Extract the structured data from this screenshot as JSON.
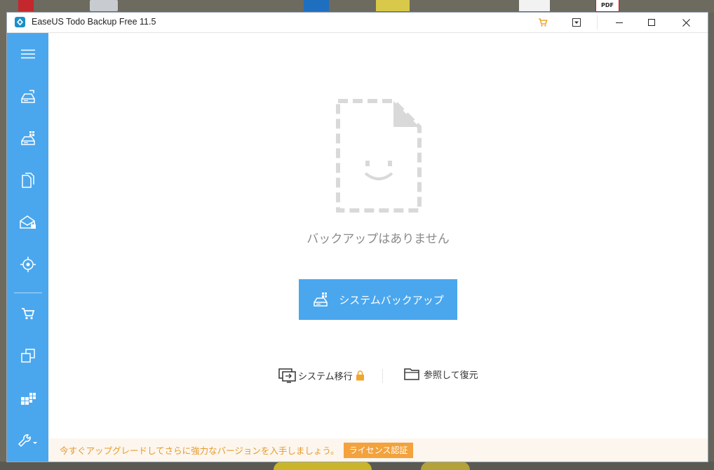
{
  "window": {
    "title": "EaseUS Todo Backup Free 11.5"
  },
  "desktop": {
    "pdf_icon_label": "PDF"
  },
  "titlebar_icons": {
    "cart": "cart-icon",
    "dropdown": "dropdown-icon",
    "minimize": "minimize-icon",
    "maximize": "maximize-icon",
    "close": "close-icon"
  },
  "sidebar": {
    "items": [
      {
        "icon": "menu-icon"
      },
      {
        "icon": "disk-backup-icon"
      },
      {
        "icon": "system-backup-icon"
      },
      {
        "icon": "file-backup-icon"
      },
      {
        "icon": "mail-backup-icon"
      },
      {
        "icon": "smart-backup-icon"
      },
      {
        "icon": "cart-icon"
      },
      {
        "icon": "clone-icon"
      },
      {
        "icon": "windows-icon"
      },
      {
        "icon": "tools-icon"
      }
    ]
  },
  "main": {
    "empty_message": "バックアップはありません",
    "system_backup_button": "システムバックアップ",
    "system_transfer_label": "システム移行",
    "browse_restore_label": "参照して復元"
  },
  "banner": {
    "message": "今すぐアップグレードしてさらに強力なバージョンを入手しましょう。",
    "license_button": "ライセンス認証"
  },
  "colors": {
    "accent": "#4aa7ee",
    "banner_text": "#e89a2c",
    "license_button": "#f3a23c",
    "lock": "#f0a52d"
  }
}
